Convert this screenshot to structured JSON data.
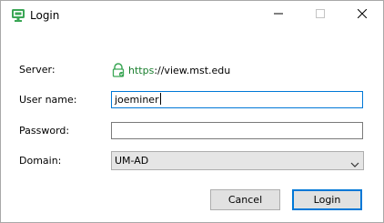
{
  "window": {
    "title": "Login",
    "minimize_icon": "minimize-icon",
    "maximize_icon": "maximize-icon",
    "close_icon": "close-icon"
  },
  "form": {
    "server_label": "Server:",
    "server_scheme": "https",
    "server_rest": "://view.mst.edu",
    "server_icon": "secure-lock-icon",
    "username_label": "User name:",
    "username_value": "joeminer",
    "password_label": "Password:",
    "password_value": "",
    "domain_label": "Domain:",
    "domain_value": "UM-AD"
  },
  "buttons": {
    "cancel_label": "Cancel",
    "login_label": "Login"
  },
  "colors": {
    "accent": "#0078d7",
    "secure_green": "#1a7f2e"
  }
}
